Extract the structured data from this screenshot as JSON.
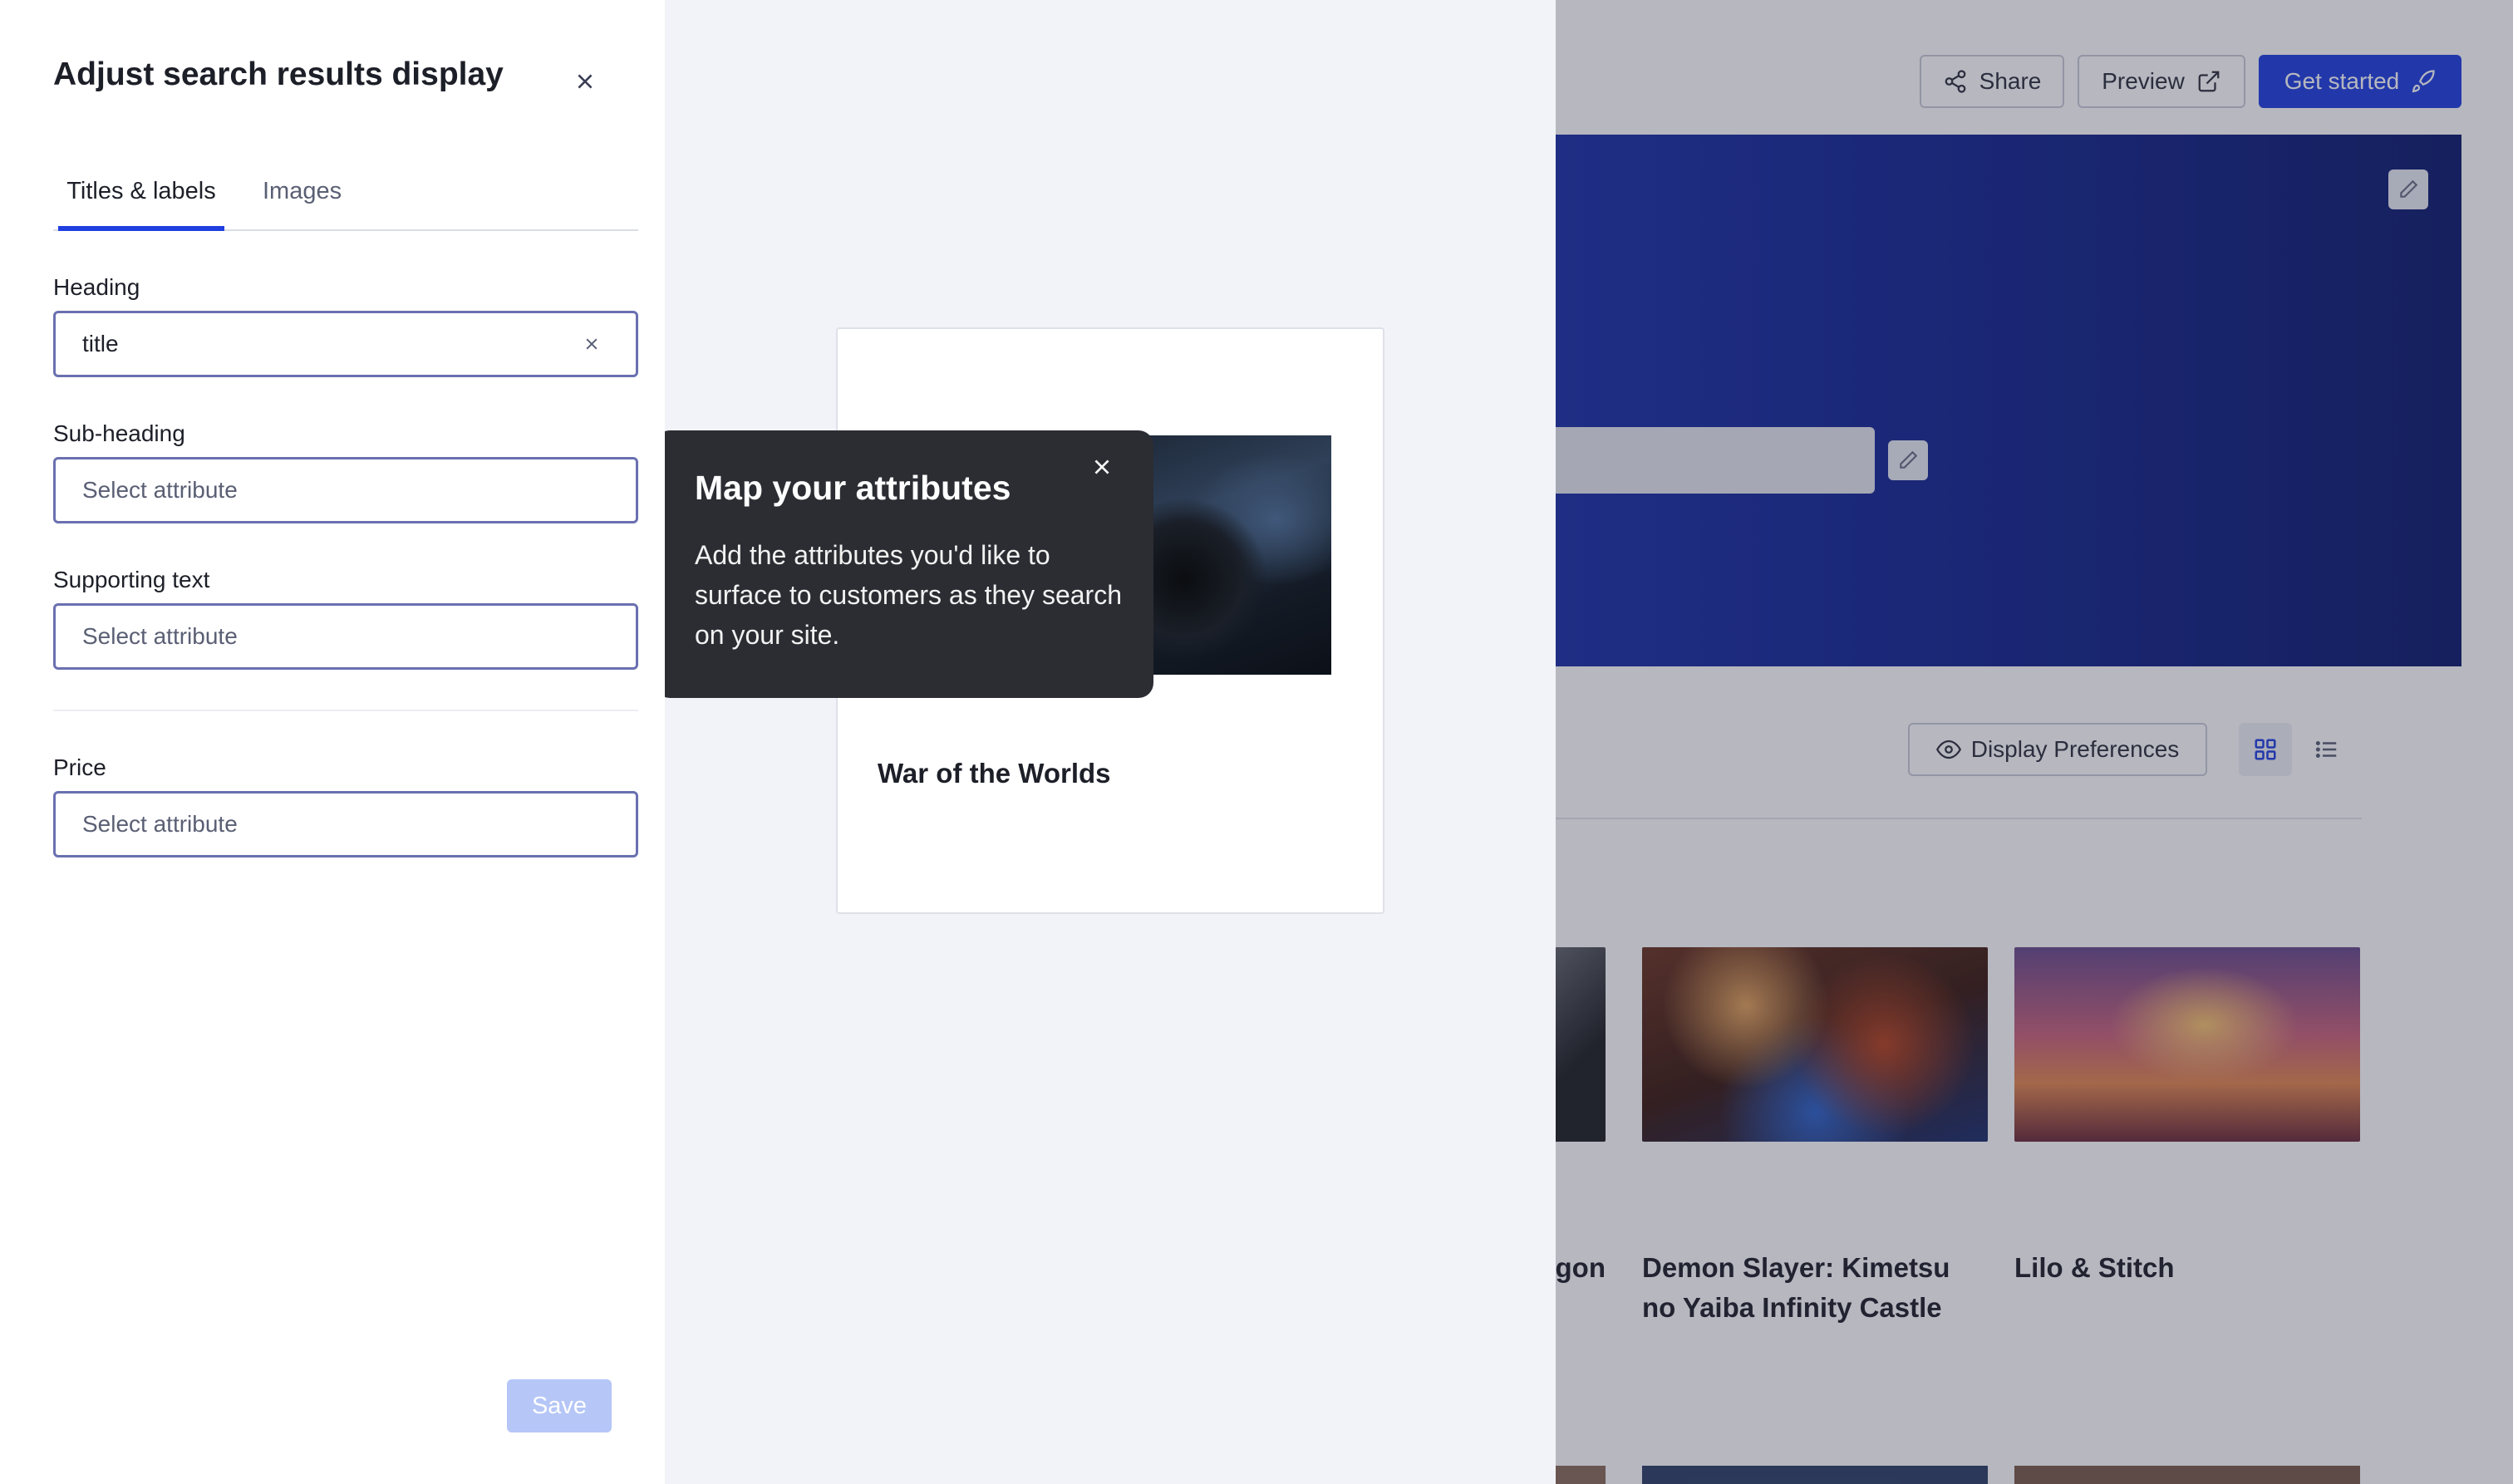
{
  "background": {
    "topbar": {
      "share_label": "Share",
      "preview_label": "Preview",
      "get_started_label": "Get started"
    },
    "display_preferences_label": "Display Preferences",
    "results": [
      {
        "title": "gon"
      },
      {
        "title": "Demon Slayer: Kimetsu no Yaiba Infinity Castle"
      },
      {
        "title": "Lilo & Stitch"
      }
    ]
  },
  "panel": {
    "title": "Adjust search results display",
    "tabs": [
      {
        "label": "Titles & labels",
        "active": true
      },
      {
        "label": "Images",
        "active": false
      }
    ],
    "fields": {
      "heading": {
        "label": "Heading",
        "value": "title"
      },
      "subheading": {
        "label": "Sub-heading",
        "placeholder": "Select attribute"
      },
      "supporting": {
        "label": "Supporting text",
        "placeholder": "Select attribute"
      },
      "price": {
        "label": "Price",
        "placeholder": "Select attribute"
      }
    },
    "save_label": "Save"
  },
  "preview": {
    "card_title": "War of the Worlds"
  },
  "tooltip": {
    "title": "Map your attributes",
    "body": "Add the attributes you'd like to surface to customers as they search on your site."
  },
  "colors": {
    "accent": "#1f3fe0",
    "tooltip_bg": "#2b2d33",
    "save_disabled": "#b5c6f7"
  }
}
